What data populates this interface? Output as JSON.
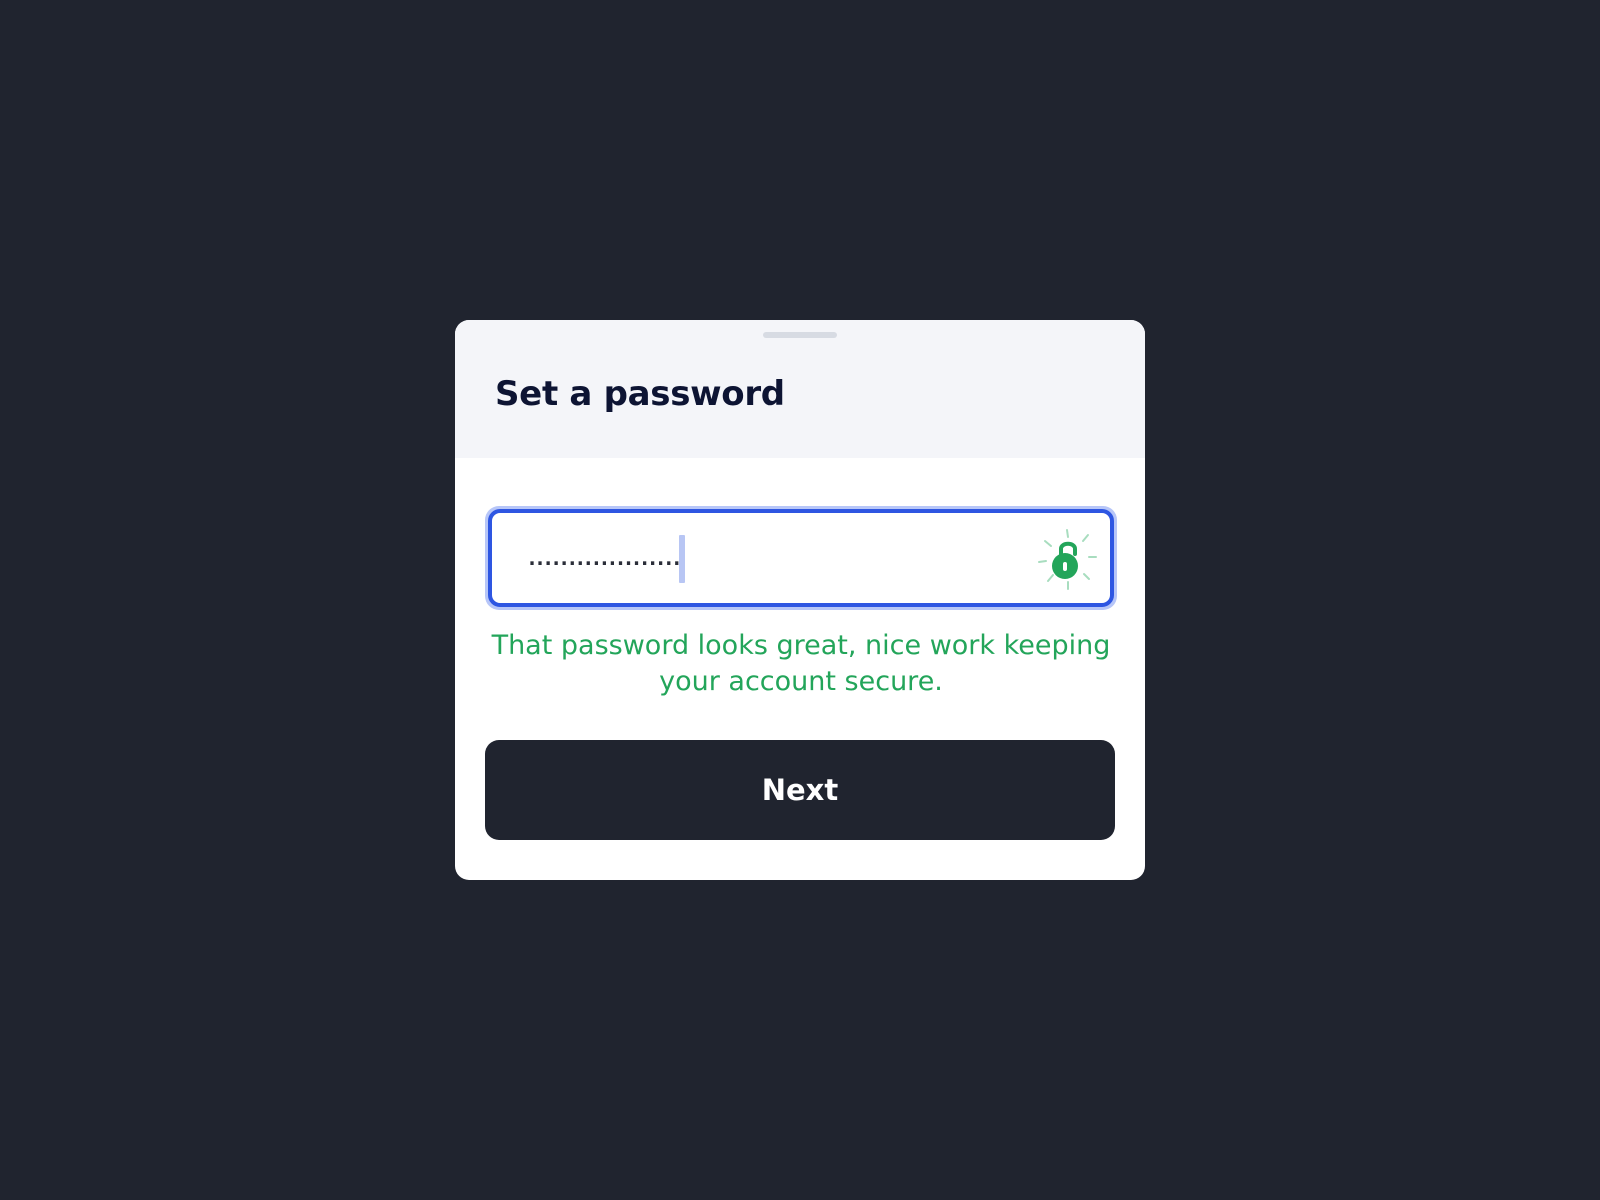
{
  "dialog": {
    "title": "Set a password"
  },
  "password_field": {
    "masked_value": "...................",
    "strength_icon": "unlocked-padlock-icon",
    "strength_color": "#23a55a",
    "focus_color": "#2e56e2"
  },
  "feedback": {
    "message": "That password looks great, nice work keeping your account secure."
  },
  "actions": {
    "next_label": "Next"
  },
  "colors": {
    "backdrop": "#20242f",
    "header_background": "#f4f5f9",
    "title_text": "#0d1433"
  }
}
